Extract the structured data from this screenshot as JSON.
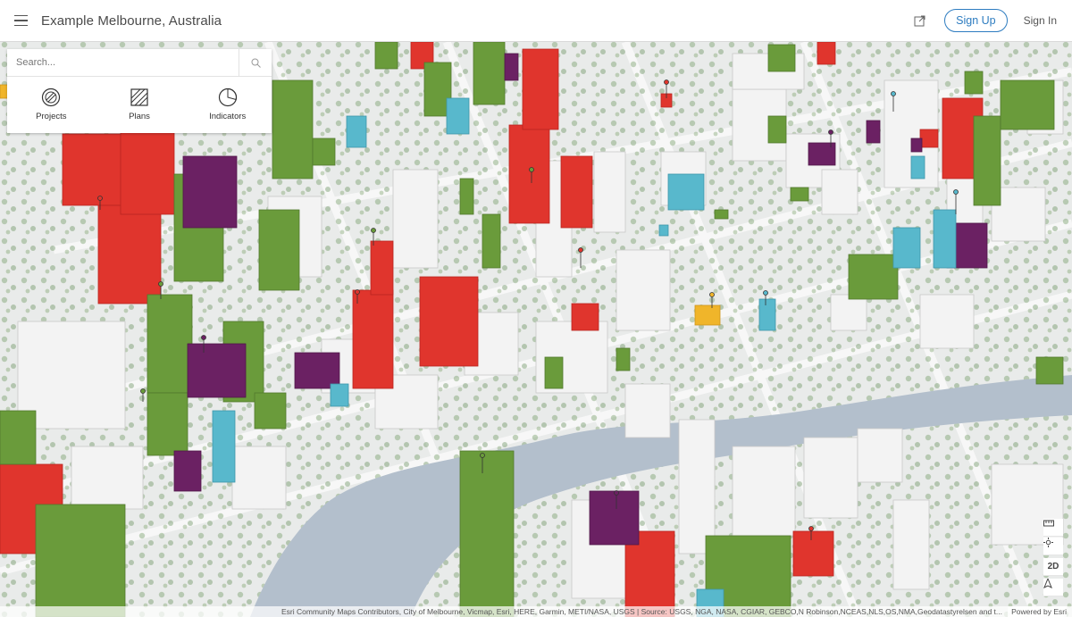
{
  "header": {
    "title": "Example Melbourne, Australia",
    "share_icon": "external-link-icon",
    "signup_label": "Sign Up",
    "signin_label": "Sign In"
  },
  "search": {
    "placeholder": "Search...",
    "icon": "search-icon"
  },
  "tools": [
    {
      "label": "Projects",
      "icon": "projects-icon"
    },
    {
      "label": "Plans",
      "icon": "plans-icon"
    },
    {
      "label": "Indicators",
      "icon": "indicators-icon"
    }
  ],
  "map_controls": {
    "measure_icon": "measure-icon",
    "daylight_icon": "daylight-icon",
    "mode_label": "2D",
    "compass_icon": "compass-icon"
  },
  "attribution": {
    "text": "Esri Community Maps Contributors, City of Melbourne, Vicmap, Esri, HERE, Garmin, METI/NASA, USGS | Source: USGS, NGA, NASA, CGIAR, GEBCO,N Robinson,NCEAS,NLS,OS,NMA,Geodatastyrelsen and t...",
    "powered": "Powered by Esri"
  },
  "colors": {
    "accent": "#2d7cc0",
    "red_buildings": "#e0352d",
    "green_buildings": "#6a9b3b",
    "purple_buildings": "#6b2163",
    "blue_buildings": "#58b8cc",
    "yellow_buildings": "#f0b52a",
    "river": "#b3bfcc"
  }
}
